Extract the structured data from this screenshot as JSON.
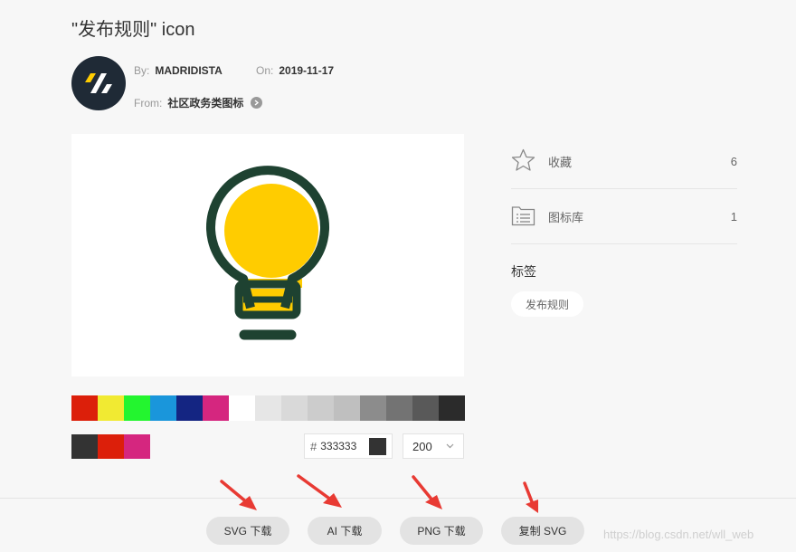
{
  "title": "\"发布规则\" icon",
  "meta": {
    "by_label": "By:",
    "by_value": "MADRIDISTA",
    "on_label": "On:",
    "on_value": "2019-11-17",
    "from_label": "From:",
    "from_value": "社区政务类图标"
  },
  "sidebar": {
    "favorite_label": "收藏",
    "favorite_count": "6",
    "library_label": "图标库",
    "library_count": "1",
    "tags_title": "标签",
    "tag": "发布规则"
  },
  "palette": [
    "#dc1f0a",
    "#f1ea32",
    "#23f52f",
    "#1a96db",
    "#142582",
    "#d5267f",
    "#ffffff",
    "#e6e6e6",
    "#d9d9d9",
    "#cccccc",
    "#bfbfbf",
    "#8c8c8c",
    "#737373",
    "#595959",
    "#2b2b2b"
  ],
  "recent_colors": [
    "#333333",
    "#dc1f0a",
    "#d5267f"
  ],
  "color_input": {
    "hash": "#",
    "value": "333333"
  },
  "size_select": {
    "value": "200"
  },
  "buttons": {
    "svg_download": "SVG 下载",
    "ai_download": "AI 下载",
    "png_download": "PNG 下载",
    "copy_svg": "复制 SVG"
  },
  "watermark": "https://blog.csdn.net/wll_web",
  "colors": {
    "bulb_fill": "#ffcc00",
    "bulb_stroke": "#1e4231",
    "annotation_arrow": "#e83a33",
    "avatar_bg": "#1f2a36",
    "avatar_accent": "#ffcc00"
  },
  "icons": {
    "avatar": "logo-slash-icon",
    "from_arrow": "chevron-right-circle-icon",
    "favorite": "star-icon",
    "library": "folder-list-icon",
    "select": "chevron-down-icon"
  }
}
